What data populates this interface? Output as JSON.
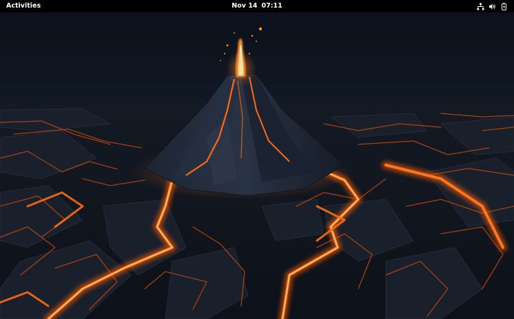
{
  "topbar": {
    "activities_label": "Activities",
    "date": "Nov 14",
    "time": "07:11",
    "status_icons": [
      "network-icon",
      "volume-icon",
      "battery-icon"
    ]
  },
  "theme": {
    "panel_bg": "#000000",
    "panel_text": "#ffffff",
    "lava": "#ff6a10",
    "ground": "#111722"
  }
}
